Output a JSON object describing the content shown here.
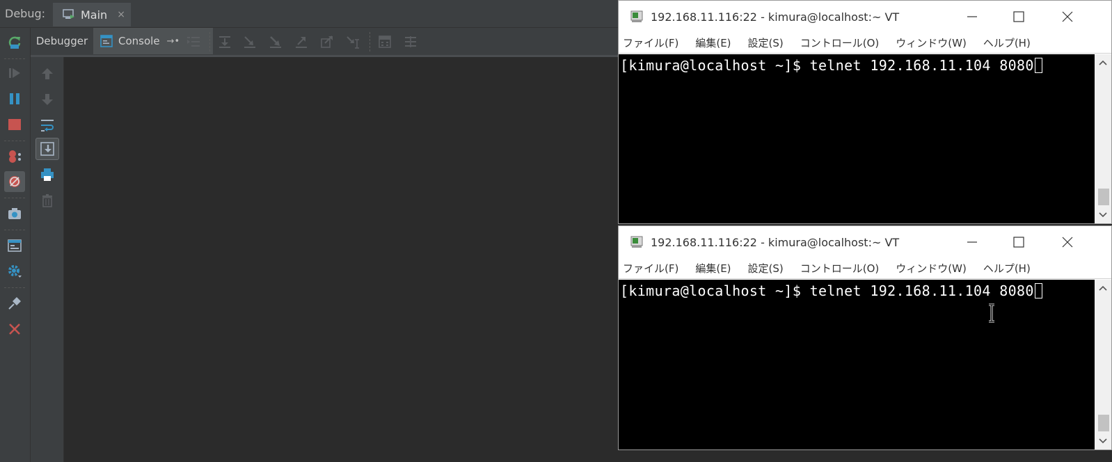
{
  "ide": {
    "debug_label": "Debug:",
    "run_tab": {
      "label": "Main",
      "close": "×",
      "icon": "run-config-icon"
    },
    "tabs": {
      "debugger": "Debugger",
      "console": "Console",
      "console_pin": "→•"
    },
    "left_toolbar_icons": [
      "rerun-icon",
      "resume-icon",
      "pause-icon",
      "stop-icon",
      "view-breakpoints-icon",
      "mute-breakpoints-icon",
      "camera-icon",
      "layout-icon",
      "settings-icon",
      "pin-icon",
      "close-icon"
    ],
    "console_toolbar_icons": [
      "up-arrow-icon",
      "down-arrow-icon",
      "soft-wrap-icon",
      "scroll-to-end-icon",
      "print-icon",
      "clear-icon"
    ],
    "colors": {
      "bg": "#2b2b2b",
      "panel": "#3c3f41",
      "accent_blue": "#3592c4",
      "stop_red": "#c75450",
      "rerun_green": "#59a869"
    }
  },
  "terminals": [
    {
      "title": "192.168.11.116:22 - kimura@localhost:~ VT",
      "menu": [
        "ファイル(F)",
        "編集(E)",
        "設定(S)",
        "コントロール(O)",
        "ウィンドウ(W)",
        "ヘルプ(H)"
      ],
      "line": "[kimura@localhost ~]$ telnet 192.168.11.104 8080"
    },
    {
      "title": "192.168.11.116:22 - kimura@localhost:~ VT",
      "menu": [
        "ファイル(F)",
        "編集(E)",
        "設定(S)",
        "コントロール(O)",
        "ウィンドウ(W)",
        "ヘルプ(H)"
      ],
      "line": "[kimura@localhost ~]$ telnet 192.168.11.104 8080"
    }
  ]
}
